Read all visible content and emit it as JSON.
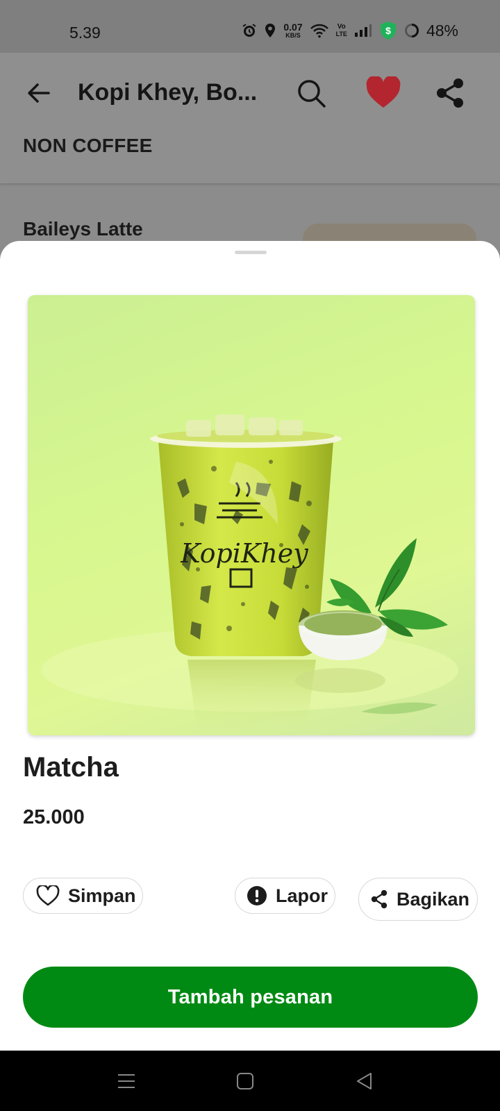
{
  "status_bar": {
    "time": "5.39",
    "network_speed_value": "0.07",
    "network_speed_unit": "KB/S",
    "volte_top": "Vo",
    "volte_bottom": "LTE",
    "battery_percent": "48%",
    "icons": [
      "alarm-icon",
      "location-icon",
      "wifi-icon",
      "volte-icon",
      "signal-icon",
      "security-shield-icon",
      "battery-ring-icon"
    ]
  },
  "header": {
    "title": "Kopi Khey, Bo...",
    "favorite_color": "#b3262f"
  },
  "background_list": {
    "section_title": "NON COFFEE",
    "item_name": "Baileys Latte"
  },
  "product": {
    "name": "Matcha",
    "price": "25.000",
    "cup_logo_text": "KopiKhey"
  },
  "actions": {
    "save_label": "Simpan",
    "report_label": "Lapor",
    "share_label": "Bagikan"
  },
  "cta": {
    "label": "Tambah pesanan",
    "color": "#008a13"
  },
  "nav_bar": {
    "icons": [
      "menu-icon",
      "home-icon",
      "back-icon"
    ]
  }
}
